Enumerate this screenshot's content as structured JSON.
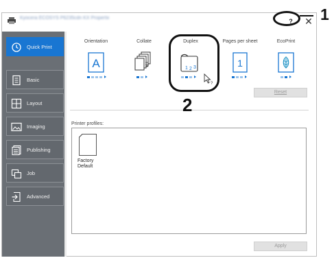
{
  "window": {
    "title": "Kyocera ECOSYS P6235cdn KX Properties",
    "help_label": "?",
    "close_label": "✕"
  },
  "sidebar": {
    "items": [
      {
        "label": "Quick Print",
        "icon": "clock-icon",
        "active": true
      },
      {
        "label": "Basic",
        "icon": "document-list-icon",
        "active": false
      },
      {
        "label": "Layout",
        "icon": "layout-grid-icon",
        "active": false
      },
      {
        "label": "Imaging",
        "icon": "image-icon",
        "active": false
      },
      {
        "label": "Publishing",
        "icon": "publishing-icon",
        "active": false
      },
      {
        "label": "Job",
        "icon": "job-icon",
        "active": false
      },
      {
        "label": "Advanced",
        "icon": "advanced-arrow-icon",
        "active": false
      }
    ]
  },
  "features": [
    {
      "label": "Orientation",
      "icon": "orientation-a-icon",
      "dots": 4,
      "active_dot": 1
    },
    {
      "label": "Collate",
      "icon": "collate-stack-icon",
      "dots": 2,
      "active_dot": 1
    },
    {
      "label": "Duplex",
      "icon": "duplex-pages-icon",
      "dots": 3,
      "active_dot": 2
    },
    {
      "label": "Pages per sheet",
      "icon": "pages-per-sheet-icon",
      "dots": 3,
      "active_dot": 1
    },
    {
      "label": "EcoPrint",
      "icon": "ecoprint-leaf-icon",
      "dots": 2,
      "active_dot": 2
    }
  ],
  "duplex_page_numbers": [
    "1",
    "2",
    "3"
  ],
  "pages_per_sheet_number": "1",
  "orientation_letter": "A",
  "reset_label": "Reset",
  "profiles": {
    "heading": "Printer profiles:",
    "items": [
      {
        "line1": "Factory",
        "line2": "Default"
      }
    ]
  },
  "apply_label": "Apply",
  "callouts": {
    "one": "1",
    "two": "2"
  },
  "colors": {
    "accent": "#1976d2",
    "sidebar_bg": "#6a6f75"
  }
}
